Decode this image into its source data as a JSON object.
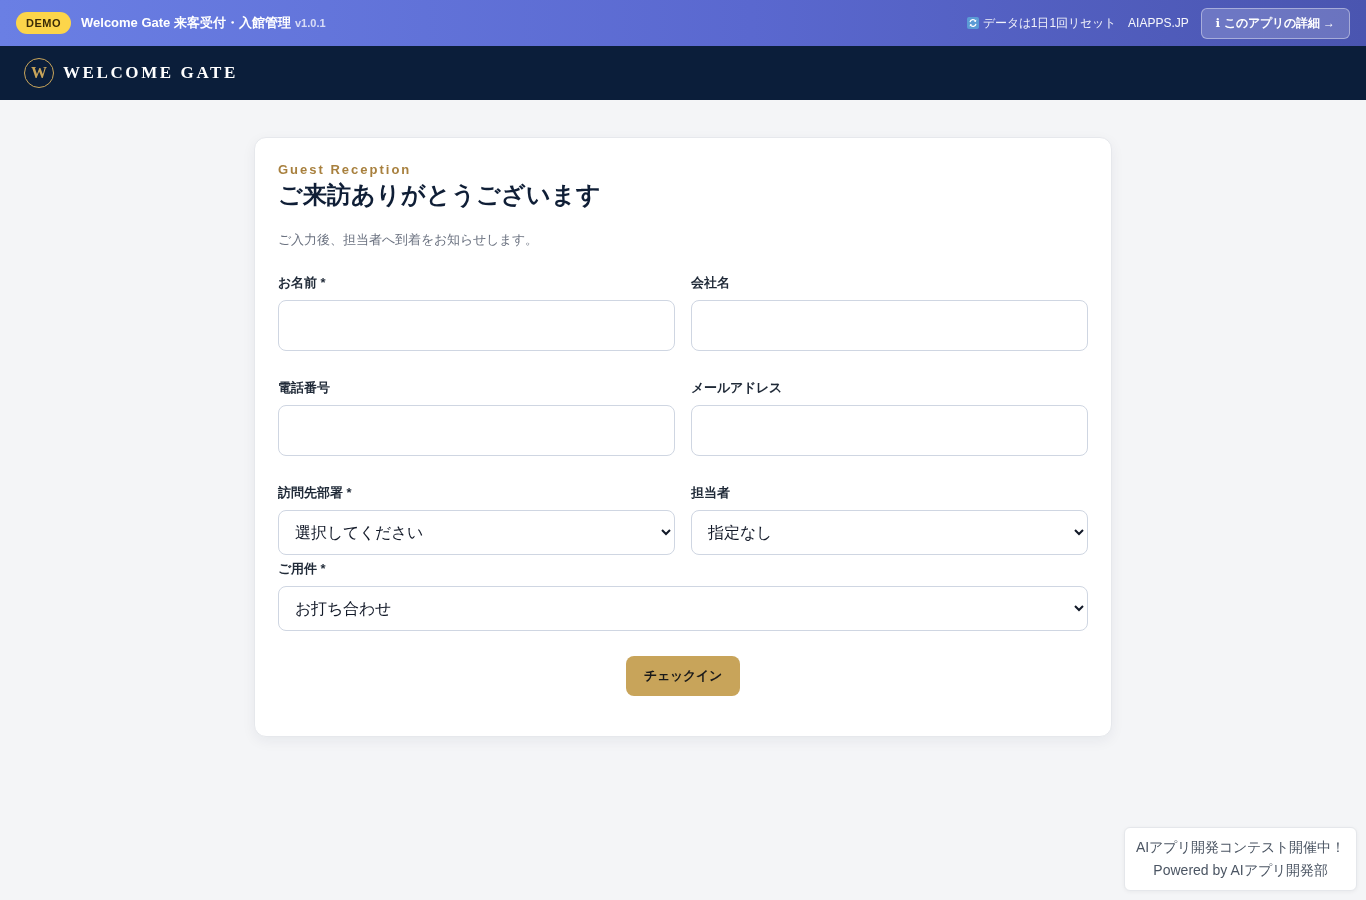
{
  "top_bar": {
    "badge": "DEMO",
    "title": "Welcome Gate 来客受付・入館管理",
    "version": "v1.0.1",
    "reset_note": "データは1日1回リセット",
    "site_link": "AIAPPS.JP",
    "details_button": "ℹ このアプリの詳細 →"
  },
  "header": {
    "logo_letter": "W",
    "brand": "WELCOME GATE"
  },
  "form": {
    "eyebrow": "Guest Reception",
    "heading": "ご来訪ありがとうございます",
    "description": "ご入力後、担当者へ到着をお知らせします。",
    "rows": [
      [
        {
          "label": "お名前 *",
          "kind": "text"
        },
        {
          "label": "会社名",
          "kind": "text"
        }
      ],
      [
        {
          "label": "電話番号",
          "kind": "text"
        },
        {
          "label": "メールアドレス",
          "kind": "text"
        }
      ],
      [
        {
          "label": "訪問先部署 *",
          "kind": "select",
          "value": "選択してください"
        },
        {
          "label": "担当者",
          "kind": "select",
          "value": "指定なし"
        }
      ],
      [
        {
          "label": "ご用件 *",
          "kind": "select",
          "value": "お打ち合わせ"
        }
      ]
    ],
    "submit_button": "チェックイン"
  },
  "promo_badge": {
    "lines": [
      "AIアプリ開発コンテスト開催中！",
      "Powered by AIアプリ開発部"
    ]
  }
}
